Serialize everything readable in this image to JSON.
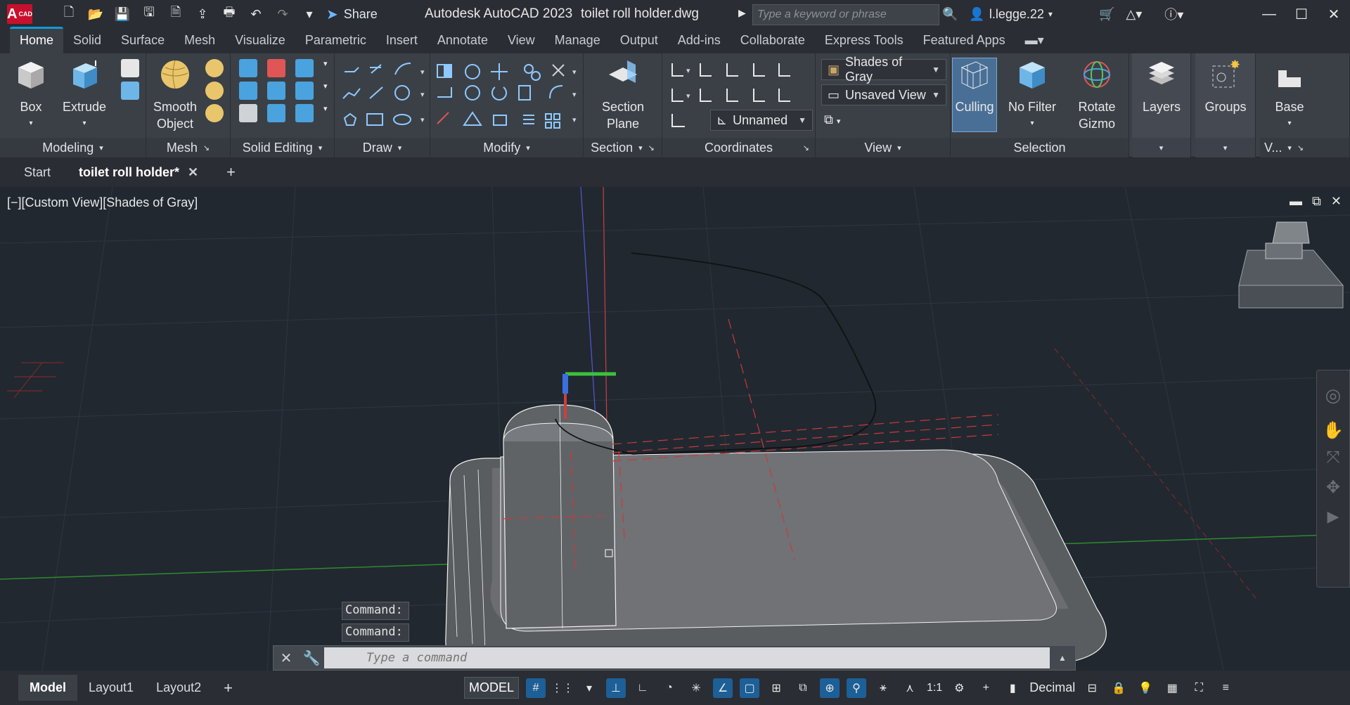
{
  "title_bar": {
    "logo_text": "A",
    "logo_sub": "CAD",
    "share_label": "Share",
    "app_title": "Autodesk AutoCAD 2023",
    "doc_title": "toilet roll holder.dwg",
    "search_placeholder": "Type a keyword or phrase",
    "user_name": "l.legge.22"
  },
  "ribbon_tabs": [
    "Home",
    "Solid",
    "Surface",
    "Mesh",
    "Visualize",
    "Parametric",
    "Insert",
    "Annotate",
    "View",
    "Manage",
    "Output",
    "Add-ins",
    "Collaborate",
    "Express Tools",
    "Featured Apps"
  ],
  "ribbon": {
    "modeling": {
      "label": "Modeling",
      "box": "Box",
      "extrude": "Extrude"
    },
    "mesh": {
      "label": "Mesh",
      "smooth_object_1": "Smooth",
      "smooth_object_2": "Object"
    },
    "solid_editing": {
      "label": "Solid Editing"
    },
    "draw": {
      "label": "Draw"
    },
    "modify": {
      "label": "Modify"
    },
    "section": {
      "label": "Section",
      "plane_1": "Section",
      "plane_2": "Plane"
    },
    "coordinates": {
      "label": "Coordinates",
      "ucs_combo": "Unnamed"
    },
    "view": {
      "label": "View",
      "visual_style": "Shades of Gray",
      "named_view": "Unsaved View"
    },
    "selection": {
      "label": "Selection",
      "culling": "Culling",
      "no_filter": "No Filter",
      "rotate_1": "Rotate",
      "rotate_2": "Gizmo"
    },
    "layers": {
      "label": "Layers"
    },
    "groups": {
      "label": "Groups"
    },
    "base": {
      "label": "Base",
      "panel": "V..."
    }
  },
  "file_tabs": {
    "start": "Start",
    "active": "toilet roll holder*"
  },
  "viewport": {
    "label": "[−][Custom View][Shades of Gray]",
    "cmd_history": [
      "Command:",
      "Command:"
    ],
    "cmd_placeholder": "Type a command"
  },
  "status_bar": {
    "layouts": [
      "Model",
      "Layout1",
      "Layout2"
    ],
    "model_label": "MODEL",
    "scale": "1:1",
    "units": "Decimal"
  },
  "colors": {
    "viewport_bg": "#212830",
    "ribbon_bg": "#3b4047",
    "accent": "#0f9bd7"
  }
}
